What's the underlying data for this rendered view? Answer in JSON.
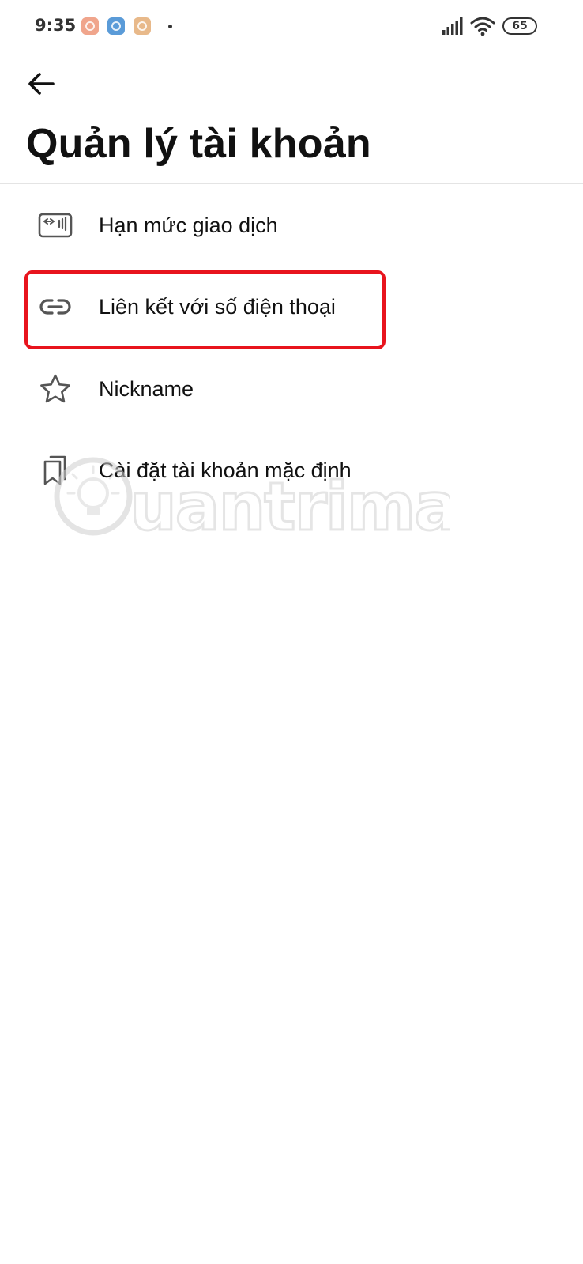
{
  "status_bar": {
    "time": "9:35",
    "battery": "65",
    "notification_icons": [
      {
        "name": "app-notification-icon",
        "color": "#f0a58c"
      },
      {
        "name": "app-notification-icon",
        "color": "#5a9bd8"
      },
      {
        "name": "app-notification-icon",
        "color": "#e8b98a"
      }
    ]
  },
  "header": {
    "back_icon": "arrow-left-icon",
    "title": "Quản lý tài khoản"
  },
  "menu": {
    "items": [
      {
        "label": "Hạn mức giao dịch",
        "icon": "card-limit-icon"
      },
      {
        "label": "Liên kết với số điện thoại",
        "icon": "link-icon",
        "highlighted": true
      },
      {
        "label": "Nickname",
        "icon": "star-icon"
      },
      {
        "label": "Cài đặt tài khoản mặc định",
        "icon": "bookmarks-icon"
      }
    ]
  },
  "watermark": {
    "text": "uantrimang"
  },
  "colors": {
    "highlight": "#e8141d",
    "text": "#111111",
    "icon": "#555555",
    "divider": "#e4e4e4"
  }
}
